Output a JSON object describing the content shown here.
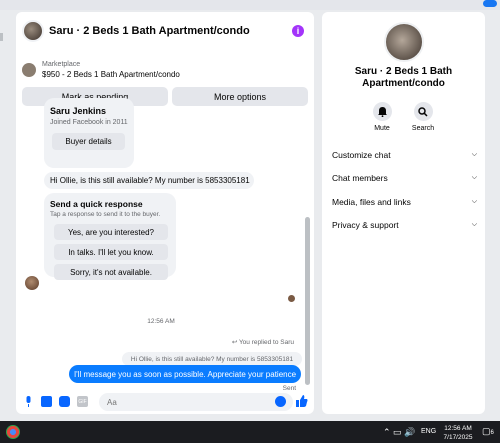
{
  "chat": {
    "title": "Saru · 2 Beds 1 Bath Apartment/condo",
    "listing_label": "Marketplace",
    "listing_price": "$950 - 2 Beds 1 Bath Apartment/condo",
    "mark_pending": "Mark as pending",
    "more_options": "More options",
    "seller_name": "Saru Jenkins",
    "seller_joined": "Joined Facebook in 2011",
    "buyer_details": "Buyer details",
    "msg_available": "Hi Ollie, is this still available? My number is 5853305181",
    "quick_title": "Send a quick response",
    "quick_sub": "Tap a response to send it to the buyer.",
    "quick_options": [
      "Yes, are you interested?",
      "In talks. I'll let you know.",
      "Sorry, it's not available."
    ],
    "timestamp": "12:56 AM",
    "replied": "↩ You replied to Saru",
    "quoted": "Hi Ollie, is this still available? My number is 5853305181",
    "msg_out": "I'll message you as soon as possible. Appreciate your patience",
    "sent": "Sent",
    "input_placeholder": "Aa"
  },
  "right_panel": {
    "title": "Saru · 2 Beds 1 Bath Apartment/condo",
    "mute": "Mute",
    "search": "Search",
    "rows": [
      "Customize chat",
      "Chat members",
      "Media, files and links",
      "Privacy & support"
    ]
  },
  "taskbar": {
    "lang": "ENG",
    "time": "12:56 AM",
    "date": "7/17/2025",
    "notif_count": "6"
  },
  "colors": {
    "accent": "#0a7cff",
    "info": "#a334fa"
  }
}
